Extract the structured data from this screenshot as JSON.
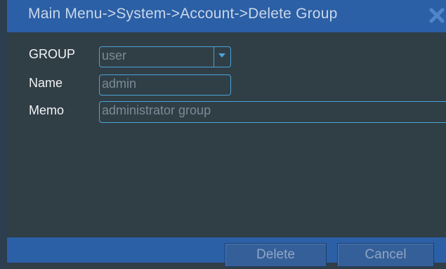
{
  "window": {
    "title": "Main Menu->System->Account->Delete Group"
  },
  "form": {
    "group": {
      "label": "GROUP",
      "value": "user"
    },
    "name": {
      "label": "Name",
      "value": "admin"
    },
    "memo": {
      "label": "Memo",
      "value": "administrator group"
    }
  },
  "buttons": {
    "delete": "Delete",
    "cancel": "Cancel"
  },
  "icons": {
    "close": "close-icon",
    "dropdown": "chevron-down-icon"
  },
  "colors": {
    "title_bar": "#2b5fa6",
    "panel": "#303e46",
    "field_border": "#4aa4d8",
    "label_text": "#f2f4f6"
  }
}
